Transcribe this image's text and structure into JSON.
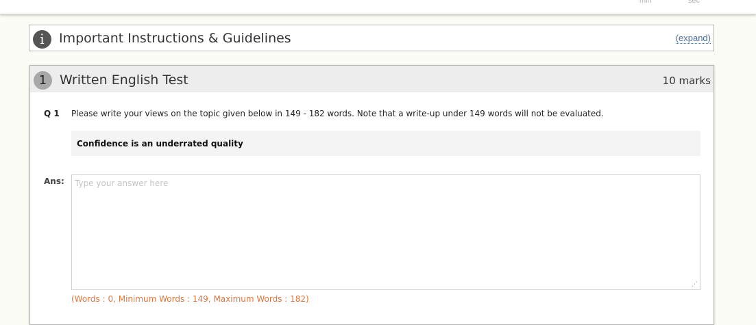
{
  "timer": {
    "min_label": "min",
    "sec_label": "sec"
  },
  "instructions": {
    "icon": "info-icon",
    "title": "Important Instructions & Guidelines",
    "expand_label": "(expand)"
  },
  "section": {
    "number": "1",
    "title": "Written English Test",
    "marks": "10 marks"
  },
  "question": {
    "label": "Q 1",
    "text": "Please write your views on the topic given below in 149 - 182 words. Note that a write-up under 149 words will not be evaluated.",
    "topic": "Confidence is an underrated quality"
  },
  "answer": {
    "label": "Ans:",
    "placeholder": "Type your answer here",
    "value": "",
    "word_count_text": "(Words : 0, Minimum Words : 149, Maximum Words : 182)"
  },
  "colors": {
    "accent_link": "#4a6fa5",
    "word_count": "#e0753b",
    "info_icon_bg": "#555555",
    "section_num_bg": "#a8a8a8"
  }
}
